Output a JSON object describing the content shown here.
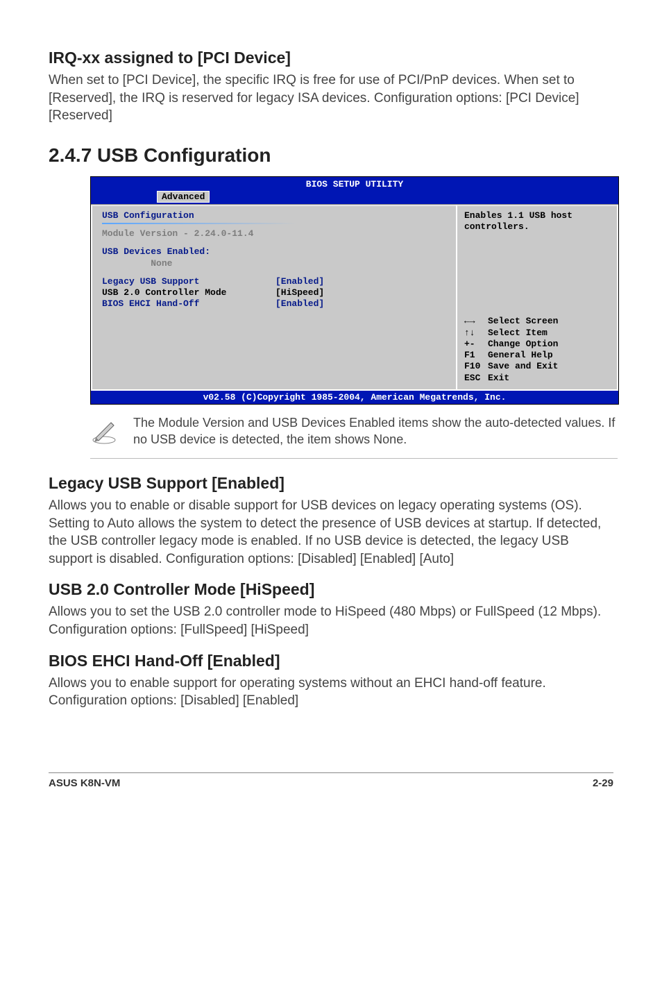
{
  "section1": {
    "heading": "IRQ-xx assigned to [PCI Device]",
    "body": "When set to [PCI Device], the specific IRQ is free for use of PCI/PnP devices. When set to [Reserved], the IRQ is reserved for legacy ISA devices. Configuration options: [PCI Device] [Reserved]"
  },
  "section2": {
    "heading": "2.4.7   USB Configuration"
  },
  "bios": {
    "title": "BIOS SETUP UTILITY",
    "tab": "Advanced",
    "panel_title": "USB Configuration",
    "module_line": "Module Version - 2.24.0-11.4",
    "devices_label": "USB Devices Enabled:",
    "devices_value": "None",
    "settings": [
      {
        "label": "Legacy USB Support",
        "value": "[Enabled]"
      },
      {
        "label": "USB 2.0 Controller Mode",
        "value": "[HiSpeed]"
      },
      {
        "label": "BIOS EHCI Hand-Off",
        "value": "[Enabled]"
      }
    ],
    "help_text": "Enables 1.1 USB host controllers.",
    "nav": {
      "arrows_lr": "←→",
      "arrows_ud": "↑↓",
      "plusminus": "+-",
      "f1": "F1",
      "f10": "F10",
      "esc": "ESC",
      "select_screen": "Select Screen",
      "select_item": "Select Item",
      "change_option": "Change Option",
      "general_help": "General Help",
      "save_exit": "Save and Exit",
      "exit": "Exit"
    },
    "footer": "v02.58 (C)Copyright 1985-2004, American Megatrends, Inc."
  },
  "note": "The Module Version and USB Devices Enabled items show the auto-detected values. If no USB device is detected, the item shows None.",
  "section3": {
    "heading": "Legacy USB Support [Enabled]",
    "body": "Allows you to enable or disable support for USB devices on legacy operating systems (OS). Setting to Auto allows the system to detect the presence of USB devices at startup. If detected, the USB controller legacy mode is enabled. If no USB device is detected, the legacy USB support is disabled. Configuration options: [Disabled] [Enabled] [Auto]"
  },
  "section4": {
    "heading": "USB 2.0 Controller Mode [HiSpeed]",
    "body": "Allows you to set the USB 2.0 controller mode to HiSpeed (480 Mbps) or FullSpeed (12 Mbps). Configuration options: [FullSpeed] [HiSpeed]"
  },
  "section5": {
    "heading": "BIOS EHCI Hand-Off [Enabled]",
    "body": "Allows you to enable support for operating systems without an EHCI hand-off feature. Configuration options: [Disabled] [Enabled]"
  },
  "footer": {
    "left": "ASUS K8N-VM",
    "right": "2-29"
  }
}
